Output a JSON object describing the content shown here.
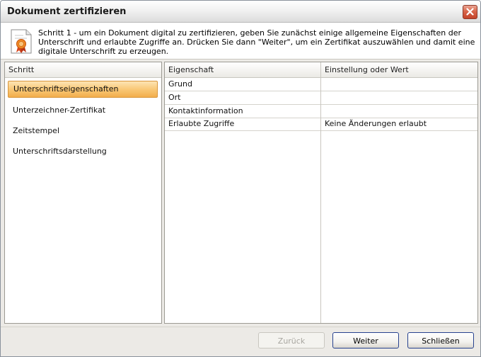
{
  "window": {
    "title": "Dokument zertifizieren"
  },
  "info": {
    "text": "Schritt 1 - um ein Dokument digital zu zertifizieren, geben Sie zunächst einige allgemeine Eigenschaften der Unterschrift und erlaubte Zugriffe an. Drücken Sie dann \"Weiter\", um ein Zertifikat auszuwählen und damit eine digitale Unterschrift zu erzeugen."
  },
  "steps": {
    "header": "Schritt",
    "items": [
      {
        "label": "Unterschriftseigenschaften",
        "selected": true
      },
      {
        "label": "Unterzeichner-Zertifikat",
        "selected": false
      },
      {
        "label": "Zeitstempel",
        "selected": false
      },
      {
        "label": "Unterschriftsdarstellung",
        "selected": false
      }
    ]
  },
  "properties": {
    "columns": [
      "Eigenschaft",
      "Einstellung oder Wert"
    ],
    "rows": [
      [
        "Grund",
        ""
      ],
      [
        "Ort",
        ""
      ],
      [
        "Kontaktinformation",
        ""
      ],
      [
        "Erlaubte Zugriffe",
        "Keine Änderungen erlaubt"
      ]
    ]
  },
  "buttons": {
    "back": "Zurück",
    "next": "Weiter",
    "close": "Schließen"
  },
  "icons": {
    "close": "close-icon",
    "certificate": "certificate-icon"
  }
}
